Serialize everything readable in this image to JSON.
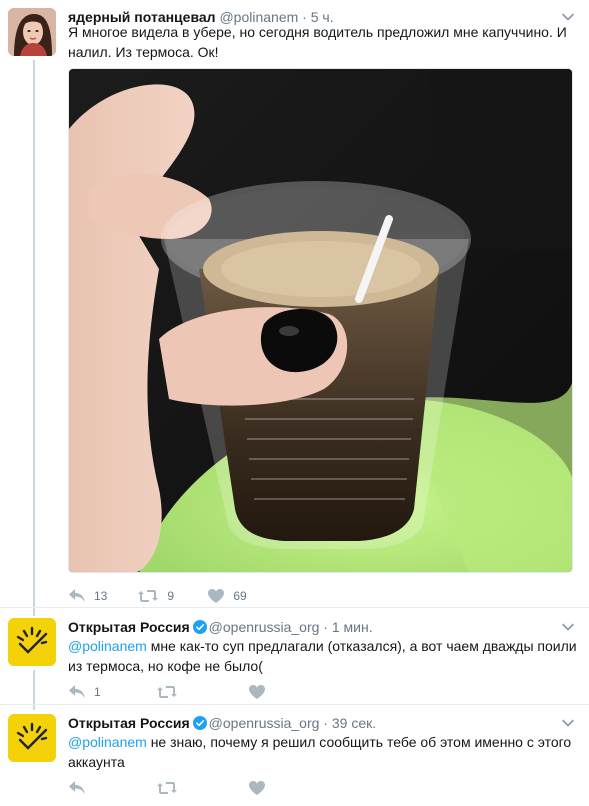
{
  "tweets": [
    {
      "name": "ядерный потанцевал",
      "handle": "@polinanem",
      "time": "5 ч.",
      "text": "Я многое видела в убере, но сегодня водитель предложил мне капуччино. И налил. Из термоса. Ок!",
      "avatar": "woman-portrait",
      "media": "coffee-cup-photo",
      "stats": {
        "replies": "13",
        "retweets": "9",
        "likes": "69"
      }
    },
    {
      "name": "Открытая Россия",
      "handle": "@openrussia_org",
      "time": "1 мин.",
      "verified": true,
      "mention": "@polinanem",
      "text": "мне как-то суп предлагали (отказался), а вот чаем дважды поили из термоса, но кофе не было(",
      "avatar": "open-russia-logo",
      "stats": {
        "replies": "1",
        "retweets": "",
        "likes": ""
      }
    },
    {
      "name": "Открытая Россия",
      "handle": "@openrussia_org",
      "time": "39 сек.",
      "verified": true,
      "mention": "@polinanem",
      "text": "не знаю, почему я решил сообщить тебе об этом именно с этого аккаунта",
      "avatar": "open-russia-logo",
      "stats": {
        "replies": "",
        "retweets": "",
        "likes": ""
      }
    }
  ],
  "separator": "·",
  "colors": {
    "link": "#1da1f2",
    "verified": "#1da1f2",
    "secondary_text": "#657786",
    "thread_line": "#ccd6dd",
    "brand_yellow": "#f3d20a"
  },
  "icons": [
    "reply-icon",
    "retweet-icon",
    "like-icon",
    "chevron-down-icon",
    "verified-badge-icon"
  ]
}
